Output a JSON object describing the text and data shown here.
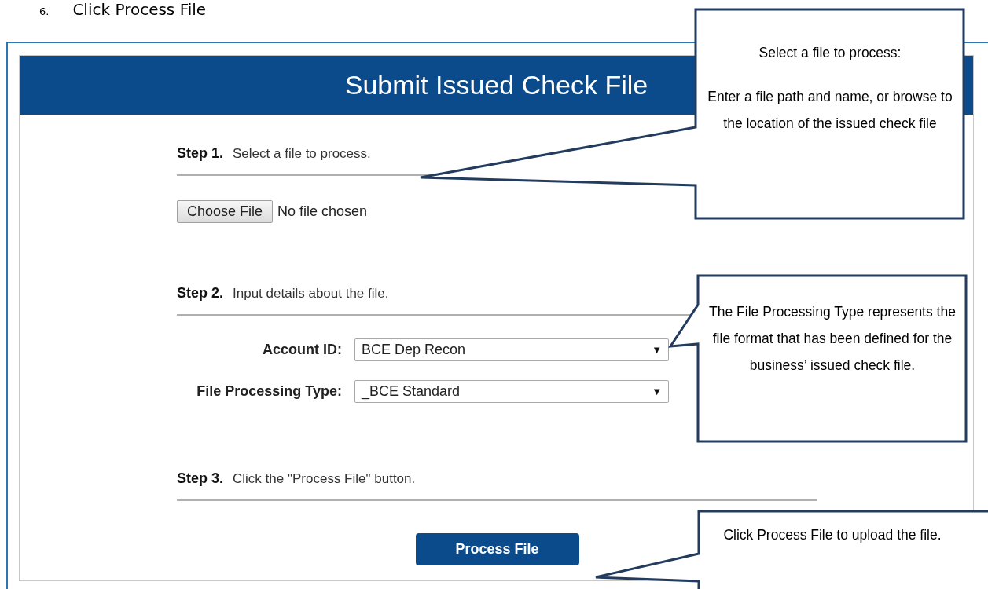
{
  "document_step": {
    "number": "6.",
    "text": "Click Process File"
  },
  "form": {
    "title": "Submit Issued Check File",
    "steps": [
      {
        "label": "Step 1.",
        "text": "Select a file to process."
      },
      {
        "label": "Step 2.",
        "text": "Input details about the file."
      },
      {
        "label": "Step 3.",
        "text": "Click the \"Process File\" button."
      }
    ],
    "file_input": {
      "button": "Choose File",
      "status": "No file chosen"
    },
    "fields": [
      {
        "label": "Account ID:",
        "value": "BCE Dep Recon",
        "arrow": "▼"
      },
      {
        "label": "File Processing Type:",
        "value": "_BCE Standard",
        "arrow": "▼"
      }
    ],
    "submit": "Process File"
  },
  "callouts": [
    {
      "paragraphs": [
        "Select a file to process:",
        "Enter a file path and name, or browse to the location of the issued check file"
      ]
    },
    {
      "paragraphs": [
        "The File Processing Type represents the file format that has been defined for the business’ issued check file."
      ]
    },
    {
      "paragraphs": [
        "Click Process File to upload the file."
      ]
    }
  ]
}
